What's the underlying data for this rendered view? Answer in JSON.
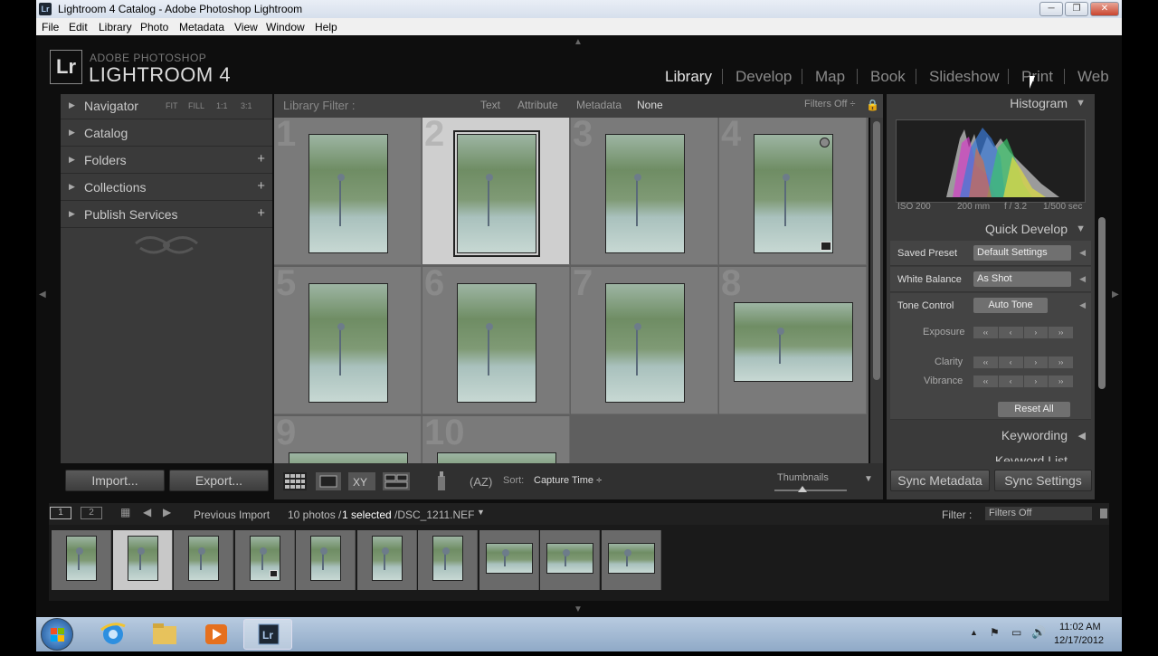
{
  "window": {
    "title": "Lightroom 4 Catalog - Adobe Photoshop Lightroom",
    "controls": {
      "minimize": "─",
      "restore": "❐",
      "close": "✕"
    }
  },
  "menu": [
    "File",
    "Edit",
    "Library",
    "Photo",
    "Metadata",
    "View",
    "Window",
    "Help"
  ],
  "logo": {
    "badge": "Lr",
    "sub": "ADOBE PHOTOSHOP",
    "main": "LIGHTROOM 4"
  },
  "modules": [
    "Library",
    "Develop",
    "Map",
    "Book",
    "Slideshow",
    "Print",
    "Web"
  ],
  "active_module": "Library",
  "left_panel": {
    "navigator": {
      "label": "Navigator",
      "options": [
        "FIT",
        "FILL",
        "1:1",
        "3:1"
      ]
    },
    "sections": [
      {
        "label": "Catalog",
        "plus": ""
      },
      {
        "label": "Folders",
        "plus": "+"
      },
      {
        "label": "Collections",
        "plus": "+"
      },
      {
        "label": "Publish Services",
        "plus": "+"
      }
    ],
    "import_label": "Import...",
    "export_label": "Export..."
  },
  "filter_bar": {
    "label": "Library Filter :",
    "options": [
      "Text",
      "Attribute",
      "Metadata",
      "None"
    ],
    "active": "None",
    "filters_off": "Filters Off ÷"
  },
  "grid": {
    "cells": [
      {
        "num": "1",
        "selected": false,
        "orient": "portrait"
      },
      {
        "num": "2",
        "selected": true,
        "orient": "portrait"
      },
      {
        "num": "3",
        "selected": false,
        "orient": "portrait"
      },
      {
        "num": "4",
        "selected": false,
        "orient": "portrait",
        "badges": true
      },
      {
        "num": "5",
        "selected": false,
        "orient": "portrait"
      },
      {
        "num": "6",
        "selected": false,
        "orient": "portrait"
      },
      {
        "num": "7",
        "selected": false,
        "orient": "portrait"
      },
      {
        "num": "8",
        "selected": false,
        "orient": "landscape"
      },
      {
        "num": "9",
        "selected": false,
        "orient": "landscape"
      },
      {
        "num": "10",
        "selected": false,
        "orient": "landscape"
      }
    ]
  },
  "toolbar": {
    "sort_label": "Sort:",
    "sort_value": "Capture Time ÷",
    "thumbnails_label": "Thumbnails"
  },
  "right_panel": {
    "histogram_label": "Histogram",
    "histogram_info": {
      "iso": "ISO 200",
      "focal": "200 mm",
      "aperture": "f / 3.2",
      "shutter": "1/500 sec"
    },
    "quick_develop_label": "Quick Develop",
    "saved_preset_label": "Saved Preset",
    "saved_preset_value": "Default Settings",
    "white_balance_label": "White Balance",
    "white_balance_value": "As Shot",
    "tone_control_label": "Tone Control",
    "auto_tone_label": "Auto Tone",
    "exposure_label": "Exposure",
    "clarity_label": "Clarity",
    "vibrance_label": "Vibrance",
    "reset_all_label": "Reset All",
    "keywording_label": "Keywording",
    "keyword_list_label": "Keyword List",
    "sync_metadata_label": "Sync Metadata",
    "sync_settings_label": "Sync Settings"
  },
  "filmstrip_bar": {
    "page1": "1",
    "page2": "2",
    "source": "Previous Import",
    "count": "10 photos /",
    "selected": "1 selected",
    "file": "/DSC_1211.NEF",
    "filter_label": "Filter :",
    "filter_value": "Filters Off"
  },
  "taskbar": {
    "time": "11:02 AM",
    "date": "12/17/2012"
  },
  "colors": {
    "panel": "#3a3a3a",
    "grid_bg": "#5f5f5f",
    "cell_selected": "#cfcfcf",
    "taskbar": "#9fb6d1"
  }
}
